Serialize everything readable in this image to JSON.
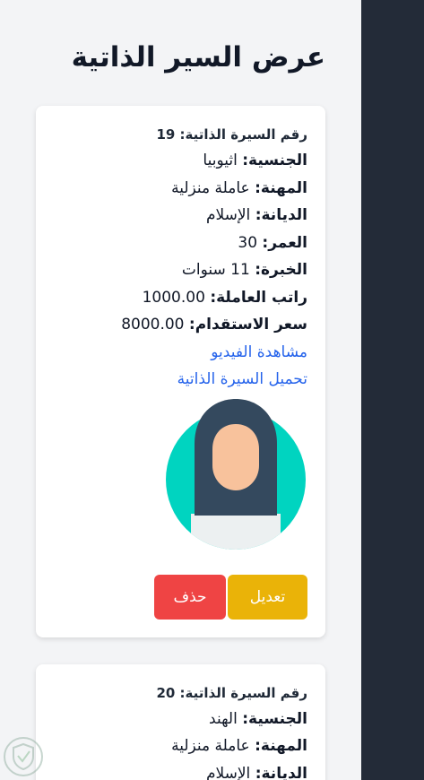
{
  "page": {
    "title": "عرض السير الذاتية"
  },
  "labels": {
    "cv_number": "رقم السيرة الذاتية:",
    "nationality": "الجنسية:",
    "profession": "المهنة:",
    "religion": "الديانة:",
    "age": "العمر:",
    "experience": "الخبرة:",
    "salary": "راتب العاملة:",
    "price": "سعر الاستقدام:"
  },
  "cvs": [
    {
      "number": "19",
      "nationality": "اثيوبيا",
      "profession": "عاملة منزلية",
      "religion": "الإسلام",
      "age": "30",
      "experience": "11 سنوات",
      "salary": "1000.00",
      "price": "8000.00",
      "video_link": "مشاهدة الفيديو",
      "download_link": "تحميل السيرة الذاتية",
      "edit_label": "تعديل",
      "delete_label": "حذف"
    },
    {
      "number": "20",
      "nationality": "الهند",
      "profession": "عاملة منزلية",
      "religion": "الإسلام"
    }
  ],
  "colors": {
    "sidebar": "#232b38",
    "link": "#2563eb",
    "edit_button": "#eab308",
    "delete_button": "#ef4444",
    "avatar_background": "#00d4c0",
    "hijab": "#34495e",
    "face": "#f8c29c"
  },
  "icons": {
    "avatar": "woman-hijab-avatar-icon",
    "watermark": "shield-logo-icon"
  }
}
